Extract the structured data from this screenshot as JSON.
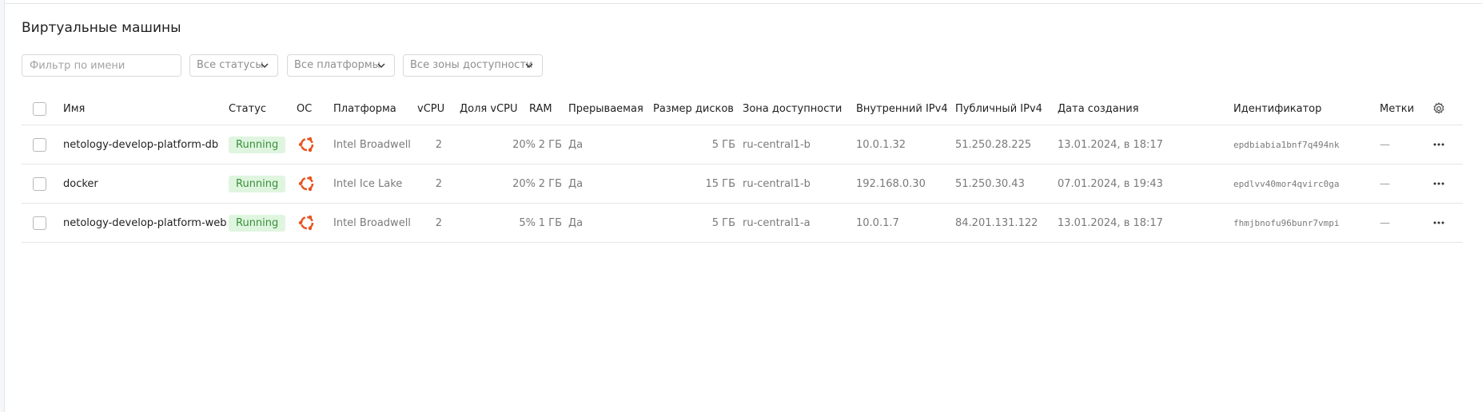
{
  "page": {
    "title": "Виртуальные машины"
  },
  "filters": {
    "name_placeholder": "Фильтр по имени",
    "status_label": "Все статусы",
    "platform_label": "Все платформы",
    "zone_label": "Все зоны доступности"
  },
  "table": {
    "columns": {
      "name": "Имя",
      "status": "Статус",
      "os": "ОС",
      "platform": "Платформа",
      "vcpu": "vCPU",
      "vcpu_share": "Доля vCPU",
      "ram": "RAM",
      "preemptible": "Прерываемая",
      "disk_size": "Размер дисков",
      "zone": "Зона доступности",
      "ipv4_internal": "Внутренний IPv4",
      "ipv4_public": "Публичный IPv4",
      "created": "Дата создания",
      "id": "Идентификатор",
      "labels": "Метки"
    },
    "rows": [
      {
        "name": "netology-develop-platform-db",
        "status": "Running",
        "os_icon": "ubuntu-icon",
        "platform": "Intel Broadwell",
        "vcpu": "2",
        "vcpu_share": "20%",
        "ram": "2 ГБ",
        "preemptible": "Да",
        "disk_size": "5 ГБ",
        "zone": "ru-central1-b",
        "ipv4_internal": "10.0.1.32",
        "ipv4_public": "51.250.28.225",
        "created": "13.01.2024, в 18:17",
        "id": "epdbiabia1bnf7q494nk",
        "labels": "—"
      },
      {
        "name": "docker",
        "status": "Running",
        "os_icon": "ubuntu-icon",
        "platform": "Intel Ice Lake",
        "vcpu": "2",
        "vcpu_share": "20%",
        "ram": "2 ГБ",
        "preemptible": "Да",
        "disk_size": "15 ГБ",
        "zone": "ru-central1-b",
        "ipv4_internal": "192.168.0.30",
        "ipv4_public": "51.250.30.43",
        "created": "07.01.2024, в 19:43",
        "id": "epdlvv40mor4qvirc0ga",
        "labels": "—"
      },
      {
        "name": "netology-develop-platform-web",
        "status": "Running",
        "os_icon": "ubuntu-icon",
        "platform": "Intel Broadwell",
        "vcpu": "2",
        "vcpu_share": "5%",
        "ram": "1 ГБ",
        "preemptible": "Да",
        "disk_size": "5 ГБ",
        "zone": "ru-central1-a",
        "ipv4_internal": "10.0.1.7",
        "ipv4_public": "84.201.131.122",
        "created": "13.01.2024, в 18:17",
        "id": "fhmjbnofu96bunr7vmpi",
        "labels": "—"
      }
    ]
  },
  "colors": {
    "status_running_bg": "#dff5df",
    "status_running_text": "#3a8f3a",
    "ubuntu_orange": "#e95420"
  }
}
